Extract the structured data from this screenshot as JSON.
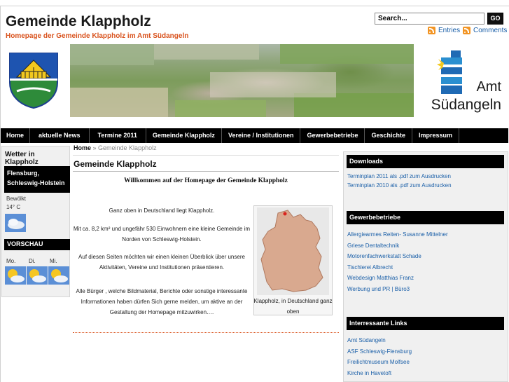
{
  "header": {
    "site_title": "Gemeinde Klappholz",
    "tagline": "Homepage der Gemeinde Klappholz im Amt Südangeln",
    "search_value": "Search...",
    "search_button": "GO",
    "feed_entries": "Entries",
    "feed_comments": "Comments"
  },
  "amt_logo": {
    "line1": "Amt",
    "line2": "Südangeln"
  },
  "nav": {
    "items": [
      {
        "label": "Home"
      },
      {
        "label": "aktuelle News"
      },
      {
        "label": "Termine 2011"
      },
      {
        "label": "Gemeinde Klappholz"
      },
      {
        "label": "Vereine / Institutionen"
      },
      {
        "label": "Gewerbebetriebe"
      },
      {
        "label": "Geschichte"
      },
      {
        "label": "Impressum"
      }
    ]
  },
  "weather": {
    "title": "Wetter in Klappholz",
    "location": "Flensburg, Schleswig-Holstein",
    "condition": "Bewölkt",
    "temperature": "14° C",
    "forecast_title": "VORSCHAU",
    "days": [
      {
        "label": "Mo."
      },
      {
        "label": "Di."
      },
      {
        "label": "Mi."
      }
    ]
  },
  "main": {
    "breadcrumb_home": "Home",
    "breadcrumb_sep": " » ",
    "breadcrumb_current": "Gemeinde Klappholz",
    "page_title": "Gemeinde Klappholz",
    "welcome": "Willkommen auf der Homepage der Gemeinde Klappholz",
    "p1": "Ganz oben in Deutschland liegt Klappholz.",
    "p2": "Mit ca. 8,2 km² und ungefähr 530 Einwohnern eine kleine Gemeinde im Norden von Schleswig-Holstein.",
    "p3": "Auf diesen Seiten möchten wir einen kleinen Überblick über unsere Aktivitäten, Vereine und Institutionen präsentieren.",
    "p4": "Alle Bürger , welche Bildmaterial, Berichte oder sonstige interessante Informationen haben dürfen Sich gerne melden, um aktive an der Gestaltung der Homepage mitzuwirken….",
    "map_caption": "Klappholz, in Deutschland ganz oben"
  },
  "sidebar": {
    "downloads_title": "Downloads",
    "downloads": [
      {
        "label": "Terminplan 2011 als .pdf zum Ausdrucken"
      },
      {
        "label": "Terminplan 2010 als .pdf zum Ausdrucken"
      }
    ],
    "gewerbe_title": "Gewerbebetriebe",
    "gewerbe": [
      {
        "label": "Allergiearmes Reiten- Susanne Mittelner"
      },
      {
        "label": "Griese Dentaltechnik"
      },
      {
        "label": "Motorenfachwerkstatt Schade"
      },
      {
        "label": "Tischlerei Albrecht"
      },
      {
        "label": "Webdesign Matthias Franz"
      },
      {
        "label": "Werbung und PR | Büro3"
      }
    ],
    "links_title": "Interressante Links",
    "links": [
      {
        "label": "Amt Südangeln"
      },
      {
        "label": "ASF Schleswig-Flensburg"
      },
      {
        "label": "Freilichtmuseum Molfsee"
      },
      {
        "label": "Kirche in Havetoft"
      }
    ]
  },
  "colors": {
    "accent": "#d9531e",
    "link": "#1a5fa8",
    "nav_bg": "#000000",
    "crest_green": "#2e8b3a",
    "crest_yellow": "#f2c81e",
    "amt_blue": "#1f6ab4"
  }
}
